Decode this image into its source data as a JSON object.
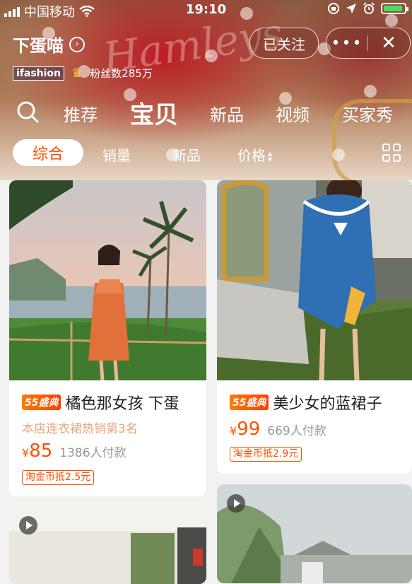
{
  "status_bar": {
    "carrier": "中国移动",
    "time": "19:10"
  },
  "shop": {
    "name": "下蛋喵",
    "follow_label": "已关注",
    "more_label": "•••",
    "close_label": "✕",
    "brand_badge": "ifashion",
    "fans": "粉丝数285万"
  },
  "nav": {
    "tabs": [
      "推荐",
      "宝贝",
      "新品",
      "视频",
      "买家秀"
    ],
    "active": "宝贝"
  },
  "filters": {
    "items": [
      "综合",
      "销量",
      "新品",
      "价格"
    ],
    "active": "综合"
  },
  "products": [
    {
      "tag": "55盛典",
      "title": "橘色那女孩 下蛋",
      "rank_text": "本店连衣裙热销第3名",
      "currency": "¥",
      "price": "85",
      "sold": "1386人付款",
      "coin": "淘金币抵2.5元"
    },
    {
      "tag": "55盛典",
      "title": "美少女的蓝裙子",
      "rank_text": "",
      "currency": "¥",
      "price": "99",
      "sold": "669人付款",
      "coin": "淘金币抵2.9元"
    }
  ],
  "colors": {
    "accent": "#ff5000",
    "hero_red": "#b8202a",
    "battery": "#4cd964"
  },
  "icons": [
    "signal-icon",
    "wifi-icon",
    "lock-rotation-icon",
    "location-icon",
    "alarm-icon",
    "battery-icon",
    "chevron-right-icon",
    "crown-icon",
    "search-icon",
    "sort-icon",
    "grid-view-icon",
    "play-icon"
  ]
}
